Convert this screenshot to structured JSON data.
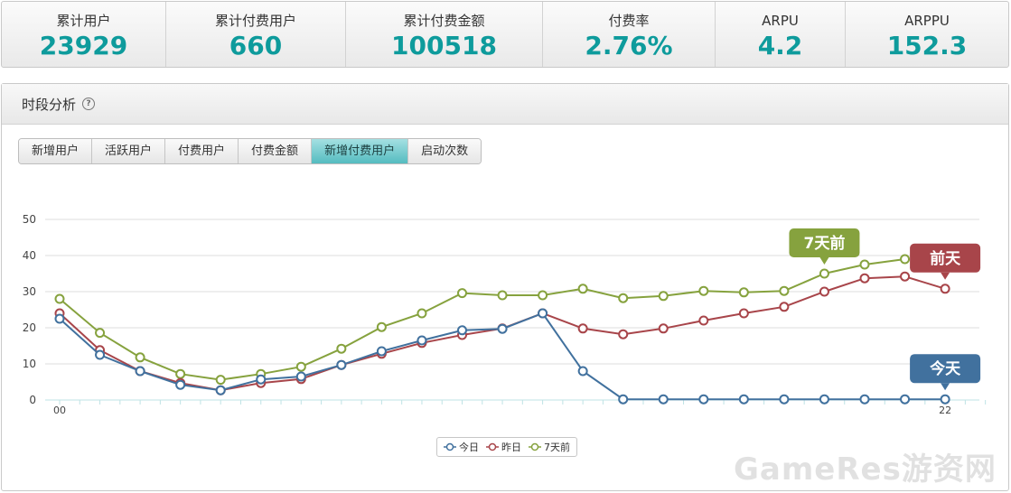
{
  "stats": [
    {
      "label": "累计用户",
      "value": "23929"
    },
    {
      "label": "累计付费用户",
      "value": "660"
    },
    {
      "label": "累计付费金额",
      "value": "100518"
    },
    {
      "label": "付费率",
      "value": "2.76%"
    },
    {
      "label": "ARPU",
      "value": "4.2"
    },
    {
      "label": "ARPPU",
      "value": "152.3"
    }
  ],
  "panel": {
    "title": "时段分析",
    "help_icon": "question-circle-icon"
  },
  "tabs": [
    {
      "label": "新增用户",
      "active": false
    },
    {
      "label": "活跃用户",
      "active": false
    },
    {
      "label": "付费用户",
      "active": false
    },
    {
      "label": "付费金额",
      "active": false
    },
    {
      "label": "新增付费用户",
      "active": true
    },
    {
      "label": "启动次数",
      "active": false
    }
  ],
  "colors": {
    "accent": "#0e9b9c",
    "tab_active": "#55bcc0",
    "series_today": "#41719e",
    "series_yesterday": "#a8454a",
    "series_7days": "#86a23e"
  },
  "chart_data": {
    "type": "line",
    "ylim": [
      0,
      50
    ],
    "yticks": [
      0,
      10,
      20,
      30,
      40,
      50
    ],
    "x": [
      0,
      1,
      2,
      3,
      4,
      5,
      6,
      7,
      8,
      9,
      10,
      11,
      12,
      13,
      14,
      15,
      16,
      17,
      18,
      19,
      20,
      21,
      22
    ],
    "x_tick_labels": [
      {
        "x": 0,
        "label": "00"
      },
      {
        "x": 22,
        "label": "22"
      }
    ],
    "grid": true,
    "legend_position": "bottom-center",
    "series": [
      {
        "name": "今日",
        "color": "#41719e",
        "values": [
          22.5,
          12.5,
          8,
          4.2,
          2.7,
          5.7,
          6.5,
          9.7,
          13.5,
          16.5,
          19.3,
          19.7,
          24,
          8,
          0.2,
          0.2,
          0.2,
          0.2,
          0.2,
          0.2,
          0.2,
          0.2,
          0.2
        ]
      },
      {
        "name": "昨日",
        "color": "#a8454a",
        "values": [
          24,
          13.8,
          8,
          4.7,
          2.7,
          4.7,
          5.8,
          9.7,
          12.8,
          15.8,
          18,
          19.8,
          24,
          19.8,
          18.2,
          19.8,
          22,
          24,
          25.8,
          30,
          33.7,
          34.2,
          30.8
        ]
      },
      {
        "name": "7天前",
        "color": "#86a23e",
        "values": [
          28,
          18.6,
          11.8,
          7.2,
          5.6,
          7.2,
          9.2,
          14.2,
          20.2,
          24,
          29.6,
          29,
          29,
          30.8,
          28.2,
          28.8,
          30.2,
          29.8,
          30.2,
          35,
          37.5,
          39,
          null
        ]
      }
    ],
    "callouts": [
      {
        "text": "7天前",
        "series": "7天前",
        "x": 19,
        "color": "#86a23e"
      },
      {
        "text": "前天",
        "series": "昨日",
        "x": 22,
        "color": "#a8454a"
      },
      {
        "text": "今天",
        "series": "今日",
        "x": 22,
        "color": "#41719e"
      }
    ]
  },
  "legend": [
    {
      "label": "今日",
      "color": "#41719e"
    },
    {
      "label": "昨日",
      "color": "#a8454a"
    },
    {
      "label": "7天前",
      "color": "#86a23e"
    }
  ],
  "watermark": "GameRes游资网"
}
